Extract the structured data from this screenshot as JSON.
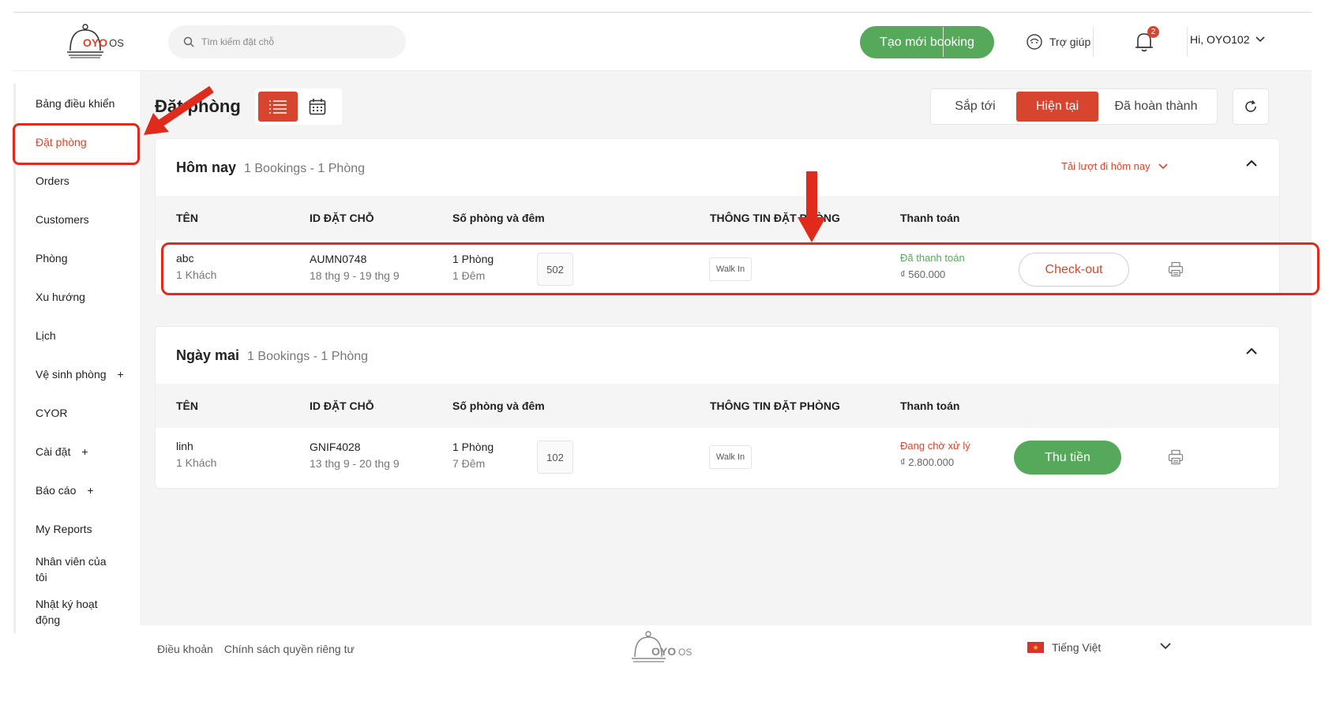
{
  "header": {
    "logo_text": "OYO",
    "logo_suffix": "OS",
    "search_placeholder": "Tìm kiếm đặt chỗ",
    "new_booking_label": "Tạo mới booking",
    "help_label": "Trợ giúp",
    "notification_count": "2",
    "user_label": "Hi, OYO102"
  },
  "sidebar": {
    "items": [
      {
        "label": "Bảng điều khiển"
      },
      {
        "label": "Đặt phòng"
      },
      {
        "label": "Orders"
      },
      {
        "label": "Customers"
      },
      {
        "label": "Phòng"
      },
      {
        "label": "Xu hướng"
      },
      {
        "label": "Lịch"
      },
      {
        "label": "Vệ sinh phòng",
        "plus": "+"
      },
      {
        "label": "CYOR"
      },
      {
        "label": "Cài đặt",
        "plus": "+"
      },
      {
        "label": "Báo cáo",
        "plus": "+"
      },
      {
        "label": "My Reports"
      },
      {
        "label": "Nhân viên của tôi"
      },
      {
        "label": "Nhật ký hoạt động"
      }
    ]
  },
  "main": {
    "page_title": "Đặt phòng",
    "tabs": [
      {
        "label": "Sắp tới"
      },
      {
        "label": "Hiện tại"
      },
      {
        "label": "Đã hoàn thành"
      }
    ],
    "columns": [
      "TÊN",
      "ID ĐẶT CHỖ",
      "Số phòng và đêm",
      "THÔNG TIN ĐẶT PHÒNG",
      "Thanh toán"
    ],
    "sections": [
      {
        "title": "Hôm nay",
        "summary": "1 Bookings - 1 Phòng",
        "link": "Tải lượt đi hôm nay",
        "row": {
          "name": "abc",
          "guests": "1 Khách",
          "booking_id": "AUMN0748",
          "dates": "18 thg 9 - 19 thg 9",
          "rooms": "1 Phòng",
          "nights": "1 Đêm",
          "room_no": "502",
          "source": "Walk In",
          "pay_status": "Đã thanh toán",
          "pay_amount": "₫ 560.000",
          "action": "Check-out"
        }
      },
      {
        "title": "Ngày mai",
        "summary": "1 Bookings - 1 Phòng",
        "row": {
          "name": "linh",
          "guests": "1 Khách",
          "booking_id": "GNIF4028",
          "dates": "13 thg 9 - 20 thg 9",
          "rooms": "1 Phòng",
          "nights": "7 Đêm",
          "room_no": "102",
          "source": "Walk In",
          "pay_status": "Đang chờ xử lý",
          "pay_amount": "₫ 2.800.000",
          "action": "Thu tiền"
        }
      }
    ]
  },
  "footer": {
    "terms": "Điều khoản",
    "privacy": "Chính sách quyền riêng tư",
    "language": "Tiếng Việt"
  },
  "colors": {
    "brand_red": "#d8452e",
    "green": "#56a85a",
    "paid": "#56a85a",
    "pending": "#d8452e"
  }
}
